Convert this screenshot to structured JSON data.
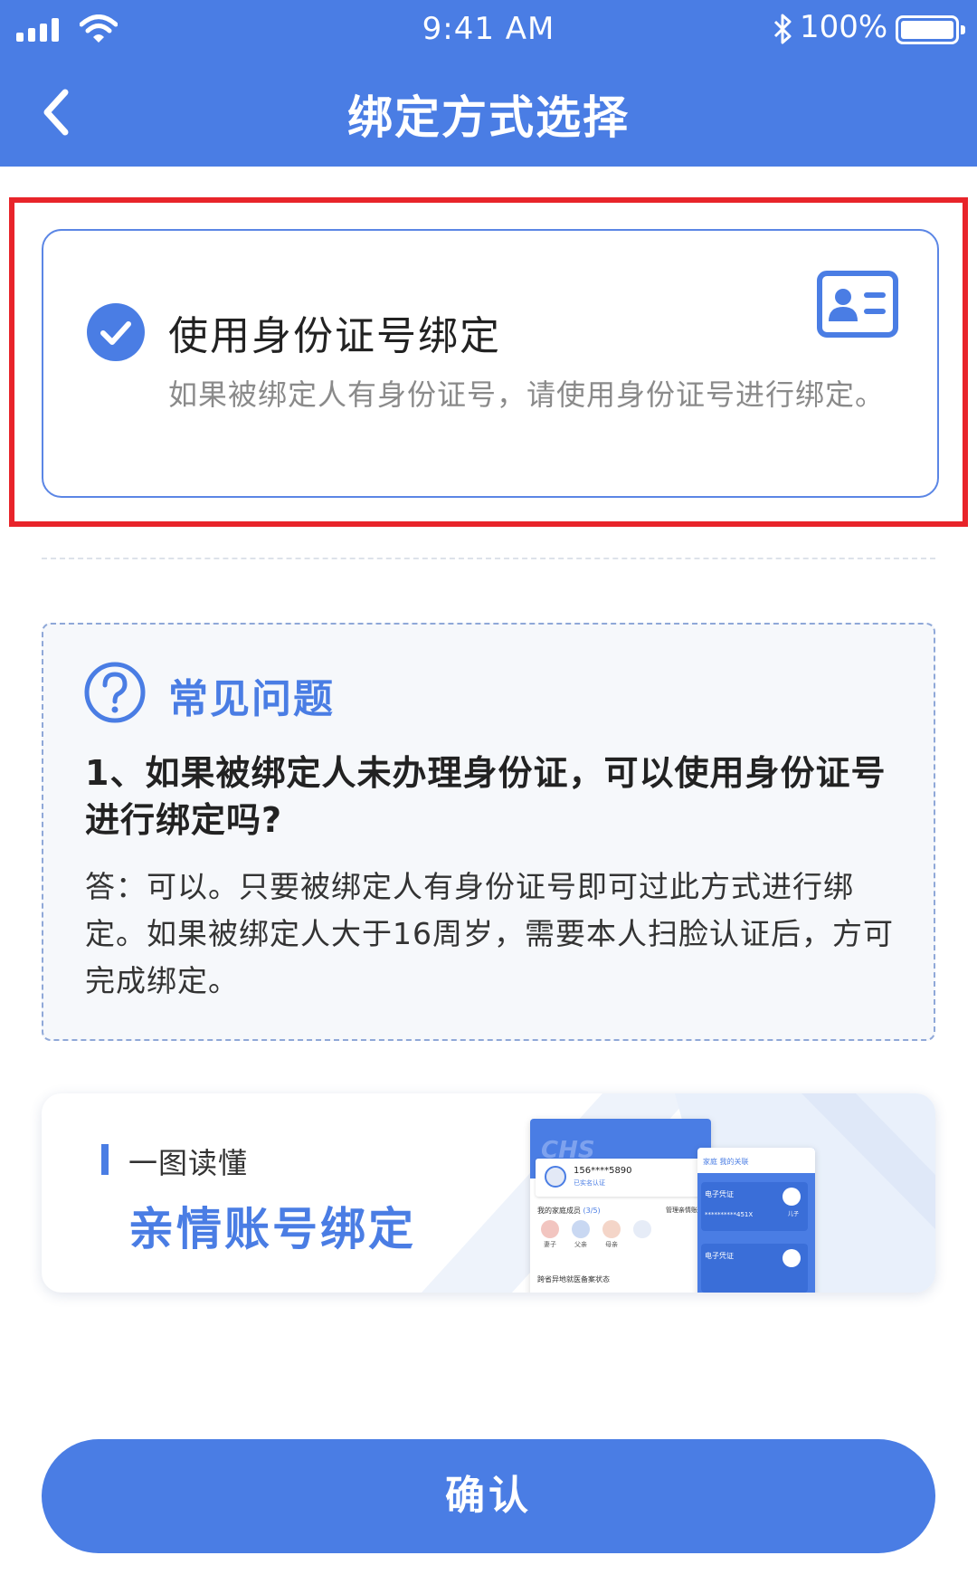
{
  "status_bar": {
    "time": "9:41 AM",
    "battery": "100%"
  },
  "header": {
    "title": "绑定方式选择",
    "back_icon": "chevron-left-icon"
  },
  "option": {
    "title": "使用身份证号绑定",
    "description": "如果被绑定人有身份证号，请使用身份证号进行绑定。",
    "selected": true,
    "icon": "id-card-icon",
    "colors": {
      "accent": "#4a7de4",
      "highlight": "#e8242a"
    }
  },
  "faq": {
    "title": "常见问题",
    "icon": "question-circle-icon",
    "question": "1、如果被绑定人未办理身份证，可以使用身份证号进行绑定吗?",
    "answer": "答：可以。只要被绑定人有身份证号即可过此方式进行绑定。如果被绑定人大于16周岁，需要本人扫脸认证后，方可完成绑定。"
  },
  "banner": {
    "subtitle": "一图读懂",
    "title": "亲情账号绑定",
    "mockup": {
      "logo": "CHS",
      "phone": "156****5890",
      "verified": "已实名认证",
      "members_label": "我的家庭成员",
      "members_count": "(3/5)",
      "manage": "管理亲情账户",
      "members": [
        "妻子",
        "父亲",
        "母亲"
      ],
      "status": "跨省异地就医备案状态",
      "tabs": "家庭    我的关联",
      "cert_label_1": "电子凭证",
      "cert_number": "**********451X",
      "cert_relation": "儿子",
      "cert_label_2": "电子凭证"
    }
  },
  "confirm": {
    "label": "确认"
  }
}
